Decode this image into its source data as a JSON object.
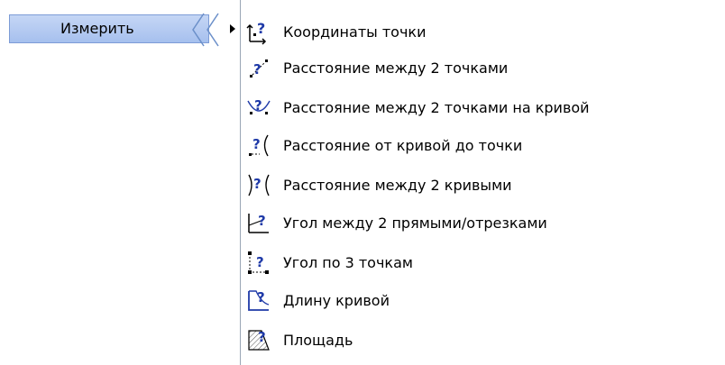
{
  "parent_menu": {
    "label": "Измерить",
    "colors": {
      "highlight": "#a6c0ee",
      "highlight_border": "#7d9cd6"
    }
  },
  "submenu": {
    "items": [
      {
        "label": "Координаты точки",
        "icon": "point-coordinates-icon"
      },
      {
        "label": "Расстояние между 2 точками",
        "icon": "distance-two-points-icon"
      },
      {
        "label": "Расстояние между 2 точками на кривой",
        "icon": "distance-points-on-curve-icon"
      },
      {
        "label": "Расстояние от кривой до точки",
        "icon": "distance-curve-to-point-icon"
      },
      {
        "label": "Расстояние между 2 кривыми",
        "icon": "distance-two-curves-icon"
      },
      {
        "label": "Угол между 2 прямыми/отрезками",
        "icon": "angle-two-lines-icon"
      },
      {
        "label": "Угол по 3 точкам",
        "icon": "angle-three-points-icon"
      },
      {
        "label": "Длину кривой",
        "icon": "curve-length-icon"
      },
      {
        "label": "Площадь",
        "icon": "area-icon"
      }
    ]
  },
  "colors": {
    "icon_question": "#1f3aa8",
    "page_background": "#fdeccd"
  }
}
